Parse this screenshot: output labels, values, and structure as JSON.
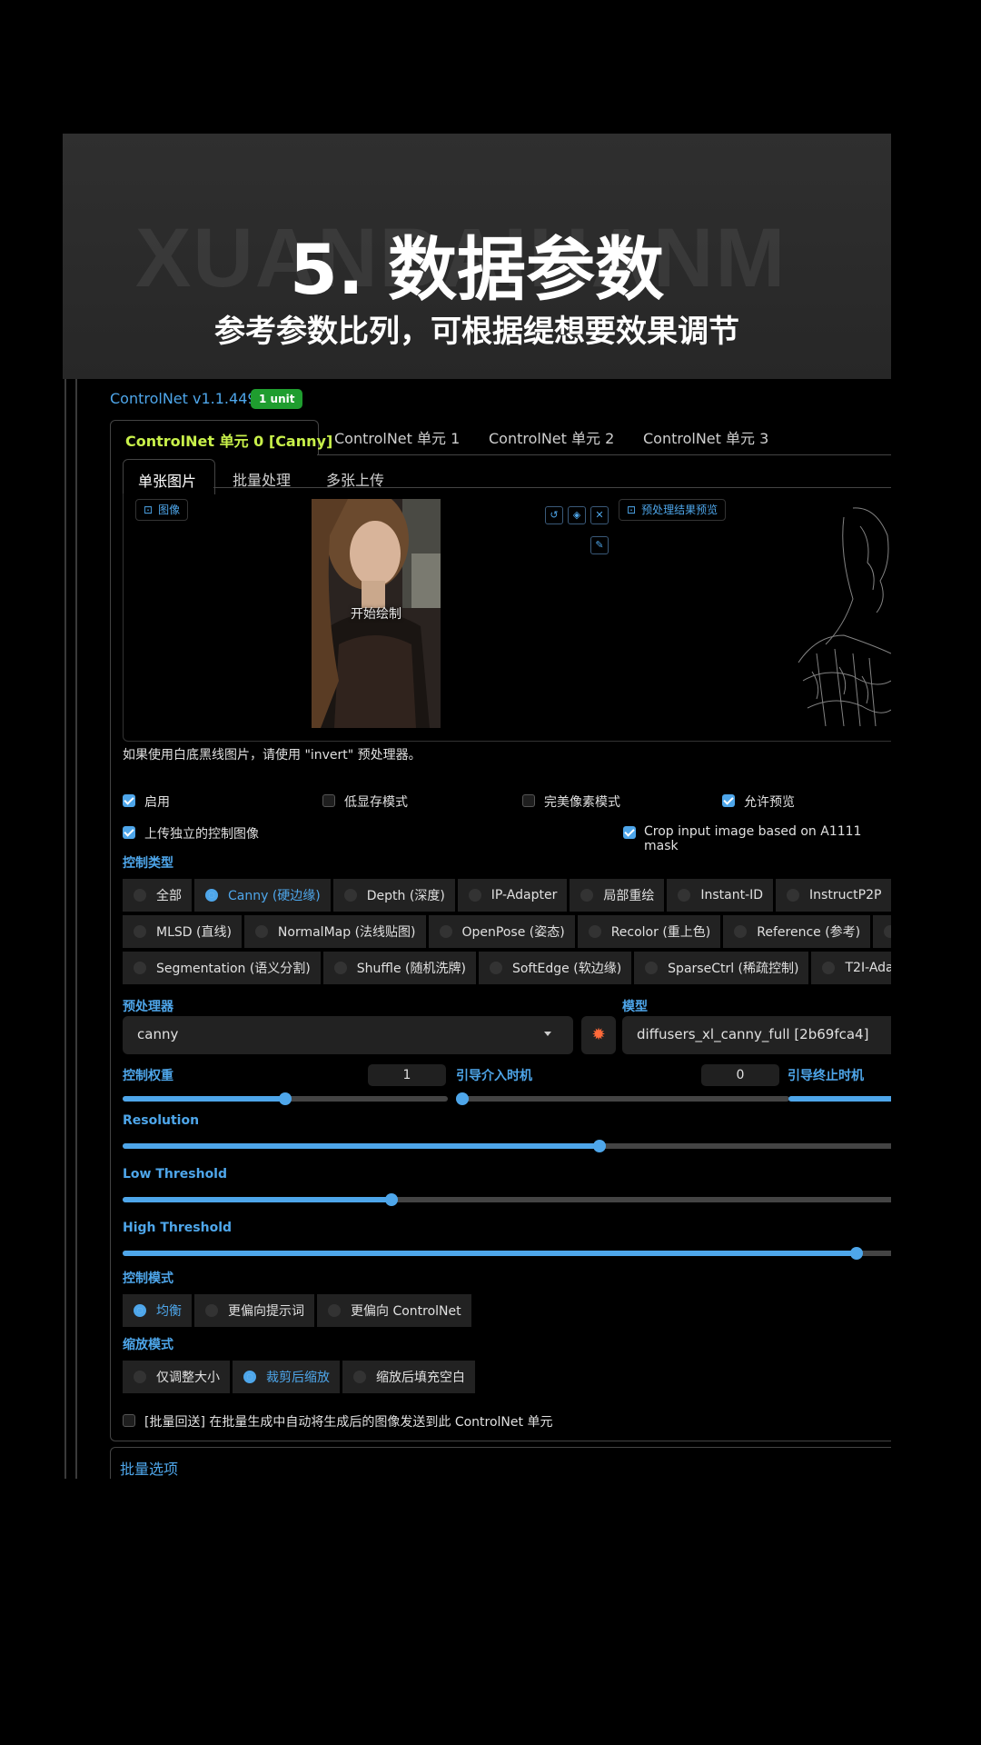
{
  "banner": {
    "bg_text": "XUANBAIHANM",
    "title": "5. 数据参数",
    "subtitle": "参考参数比列，可根据缇想要效果调节"
  },
  "header": {
    "title": "ControlNet v1.1.449",
    "badge": "1 unit"
  },
  "unit_tabs": [
    "ControlNet 单元 0 [Canny]",
    "ControlNet 单元 1",
    "ControlNet 单元 2",
    "ControlNet 单元 3"
  ],
  "image_tabs": [
    "单张图片",
    "批量处理",
    "多张上传"
  ],
  "image_area": {
    "image_label": "图像",
    "start_draw": "开始绘制",
    "preview_label": "预处理结果预览"
  },
  "hint": "如果使用白底黑线图片，请使用 \"invert\" 预处理器。",
  "checkboxes": {
    "enable": "启用",
    "low_vram": "低显存模式",
    "pixel_perfect": "完美像素模式",
    "allow_preview": "允许预览",
    "upload_independent": "上传独立的控制图像",
    "crop_input": "Crop input image based on A1111 mask"
  },
  "control_type": {
    "label": "控制类型",
    "row1": [
      "全部",
      "Canny (硬边缘)",
      "Depth (深度)",
      "IP-Adapter",
      "局部重绘",
      "Instant-ID",
      "InstructP2P"
    ],
    "row2": [
      "MLSD (直线)",
      "NormalMap (法线贴图)",
      "OpenPose (姿态)",
      "Recolor (重上色)",
      "Reference (参考)"
    ],
    "row3": [
      "Segmentation (语义分割)",
      "Shuffle (随机洗牌)",
      "SoftEdge (软边缘)",
      "SparseCtrl (稀疏控制)",
      "T2I-Adap"
    ]
  },
  "preprocessor": {
    "label": "预处理器",
    "value": "canny"
  },
  "model": {
    "label": "模型",
    "value": "diffusers_xl_canny_full [2b69fca4]"
  },
  "control_weight": {
    "label": "控制权重",
    "value": "1",
    "level": 0.5
  },
  "start_step": {
    "label": "引导介入时机",
    "value": "0",
    "level": 0.0
  },
  "end_step": {
    "label": "引导终止时机"
  },
  "resolution": {
    "label": "Resolution",
    "level": 0.62
  },
  "low_threshold": {
    "label": "Low Threshold",
    "level": 0.35
  },
  "high_threshold": {
    "label": "High Threshold",
    "level": 0.955
  },
  "control_mode": {
    "label": "控制模式",
    "options": [
      "均衡",
      "更偏向提示词",
      "更偏向 ControlNet"
    ]
  },
  "resize_mode": {
    "label": "缩放模式",
    "options": [
      "仅调整大小",
      "裁剪后缩放",
      "缩放后填充空白"
    ]
  },
  "loopback": "[批量回送] 在批量生成中自动将生成后的图像发送到此 ControlNet 单元",
  "batch_options": "批量选项",
  "colors": {
    "accent": "#4ea6ea",
    "active_tab": "#c8f04a",
    "badge": "#1f9d2f"
  }
}
